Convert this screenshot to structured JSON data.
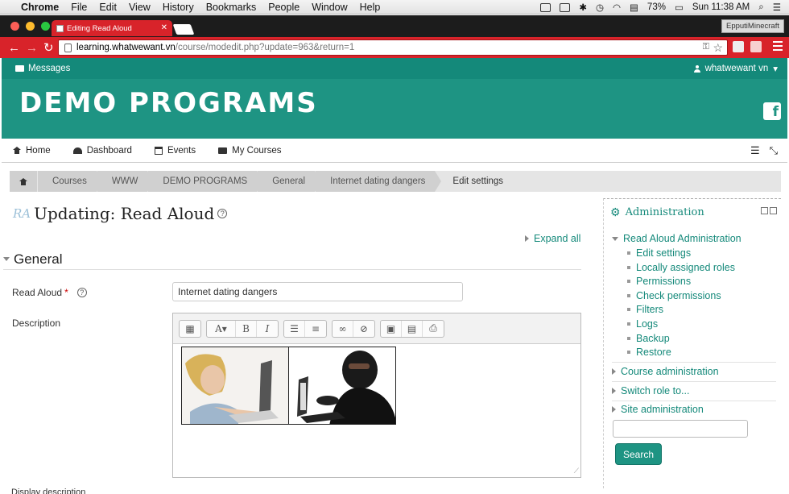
{
  "mac_menu": {
    "app": "Chrome",
    "items": [
      "File",
      "Edit",
      "View",
      "History",
      "Bookmarks",
      "People",
      "Window",
      "Help"
    ],
    "battery": "73%",
    "clock": "Sun 11:38 AM"
  },
  "browser": {
    "tab_title": "Editing Read Aloud",
    "profile": "EpputiMinecraft",
    "url_host": "learning.whatwewant.vn",
    "url_path": "/course/modedit.php?update=963&return=1"
  },
  "topnav": {
    "messages": "Messages",
    "user": "whatwewant vn"
  },
  "banner": {
    "site_title": "DEMO PROGRAMS"
  },
  "custommenu": {
    "items": [
      "Home",
      "Dashboard",
      "Events",
      "My Courses"
    ]
  },
  "breadcrumb": {
    "items": [
      "Courses",
      "WWW",
      "DEMO PROGRAMS",
      "General",
      "Internet dating dangers"
    ],
    "current": "Edit settings"
  },
  "page": {
    "icon_text": "RA",
    "heading": "Updating: Read Aloud",
    "help_glyph": "?",
    "expand_all": "Expand all",
    "section": "General",
    "name_label": "Read Aloud",
    "required_mark": "*",
    "name_value": "Internet dating dangers",
    "description_label": "Description",
    "cut_label": "Display description"
  },
  "editor": {
    "toolbar_icons": [
      "keyboard-icon",
      "font-style-icon",
      "bold-icon",
      "italic-icon",
      "bullet-list-icon",
      "numbered-list-icon",
      "link-icon",
      "unlink-icon",
      "image-icon",
      "media-icon",
      "manage-files-icon"
    ],
    "images": [
      "surprised-woman-at-laptop",
      "masked-hacker-at-laptop"
    ]
  },
  "admin_block": {
    "title": "Administration",
    "readaloud_admin": "Read Aloud Administration",
    "readaloud_links": [
      "Edit settings",
      "Locally assigned roles",
      "Permissions",
      "Check permissions",
      "Filters",
      "Logs",
      "Backup",
      "Restore"
    ],
    "course_admin": "Course administration",
    "switch_role": "Switch role to...",
    "site_admin": "Site administration",
    "search_label": "Search"
  },
  "colors": {
    "brand_teal": "#1e9483",
    "nav_teal": "#14897a",
    "browser_red": "#d8232a"
  }
}
